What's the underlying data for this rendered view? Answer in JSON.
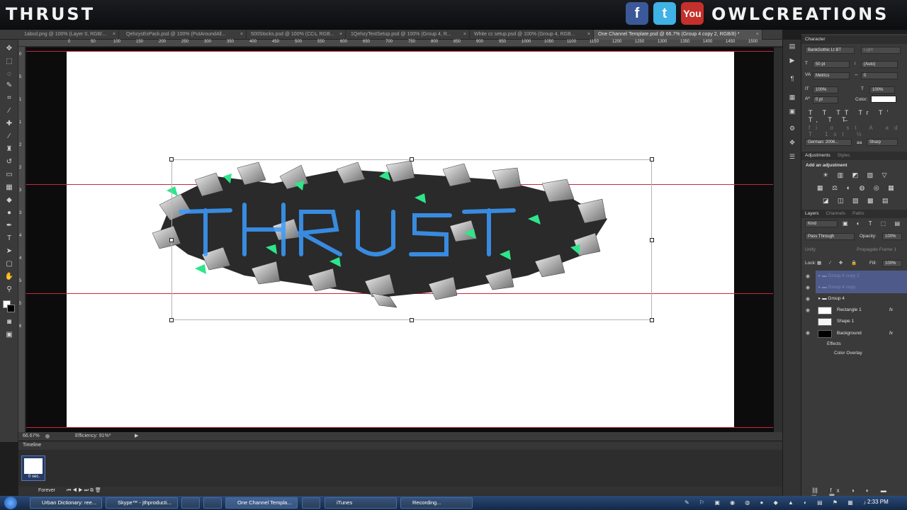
{
  "banner": {
    "left_title": "THRUST",
    "right_title": "OWLCREATIONS",
    "social": [
      "f",
      "t",
      "You Tube"
    ]
  },
  "tabs": [
    "1abcd.png @ 100% (Layer 0, RGB/...",
    "QehzysExPack.psd @ 100% (PutAroundAll...",
    "500Stocks.psd @ 100% (CCs, RGB...",
    "1QehzyTextSetup.psd @ 100% (Group 4, R...",
    "White cc setup.psd @ 100% (Group 4, RGB...",
    "One Channel Template.psd @ 66.7% (Group 4 copy 2, RGB/8) *"
  ],
  "status": {
    "zoom": "66.67%",
    "efficiency": "Efficiency: 91%*"
  },
  "timeline": {
    "title": "Timeline",
    "frame_delay": "0 sec.",
    "loop": "Forever"
  },
  "character": {
    "title": "Character",
    "font": "BankGothic Lt BT",
    "style": "Light",
    "size": "50 pt",
    "leading": "(Auto)",
    "kerning": "Metrics",
    "tracking": "0",
    "vscale": "100%",
    "hscale": "100%",
    "baseline": "0 pt",
    "color_label": "Color:",
    "language": "German: 2006...",
    "aa_label": "aa",
    "antialias": "Sharp"
  },
  "adjustments": {
    "tab1": "Adjustments",
    "tab2": "Styles",
    "prompt": "Add an adjustment"
  },
  "layers_panel": {
    "tabs": [
      "Layers",
      "Channels",
      "Paths"
    ],
    "kind": "Kind",
    "blend": "Pass Through",
    "opacity_label": "Opacity:",
    "opacity": "100%",
    "unify": "Unify:",
    "propagate": "Propagate Frame 1",
    "lock": "Lock:",
    "fill_label": "Fill:",
    "fill": "100%",
    "layers": [
      "Group 4 copy 2",
      "Group 4 copy",
      "Group 4",
      "Rectangle 1",
      "Shape 1",
      "Background"
    ],
    "effects": "Effects",
    "color_overlay": "Color Overlay"
  },
  "ruler_top": [
    "0",
    "50",
    "100",
    "150",
    "200",
    "250",
    "300",
    "350",
    "400",
    "450",
    "500",
    "550",
    "600",
    "650",
    "700",
    "750",
    "800",
    "850",
    "900",
    "950",
    "1000",
    "1050",
    "1100",
    "1150",
    "1200",
    "1250",
    "1300",
    "1350",
    "1400",
    "1450",
    "1500"
  ],
  "ruler_left": [
    "0",
    "5",
    "1",
    "1",
    "2",
    "2",
    "3",
    "3",
    "4",
    "4",
    "5",
    "5",
    "6"
  ],
  "taskbar": {
    "items": [
      "Urban Dictionary: ree...",
      "Skype™ - jthproducti...",
      "",
      "",
      "One Channel Templa...",
      "",
      "iTunes",
      "Recording..."
    ],
    "clock": "2:33 PM"
  },
  "colors": {
    "guide": "#c8283c",
    "selection": "#4e5b8a",
    "accent": "#2ee68a"
  }
}
